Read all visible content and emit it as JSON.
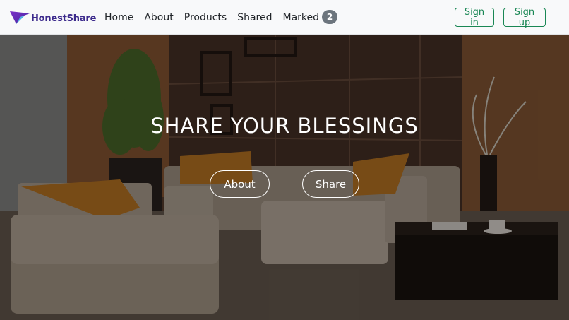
{
  "brand": {
    "name": "HonestShare",
    "logo_icon": "triangle-logo-icon"
  },
  "nav": {
    "home": "Home",
    "about": "About",
    "products": "Products",
    "shared": "Shared",
    "marked": "Marked",
    "marked_count": "2"
  },
  "auth": {
    "signin": "Sign in",
    "signup": "Sign up"
  },
  "hero": {
    "title": "SHARE YOUR BLESSINGS",
    "btn_about": "About",
    "btn_share": "Share"
  },
  "colors": {
    "accent": "#198754",
    "brand": "#3c2a8c",
    "badge": "#6c757d"
  }
}
